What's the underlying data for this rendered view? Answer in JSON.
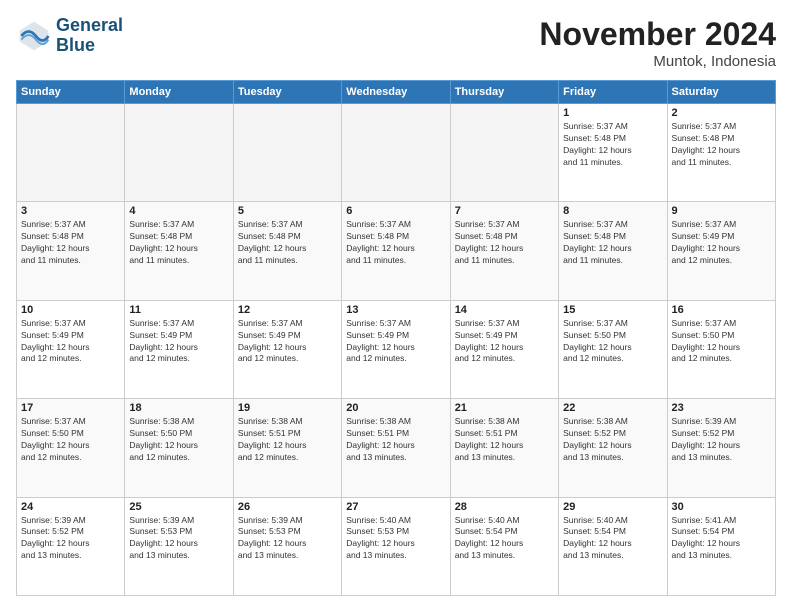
{
  "logo": {
    "line1": "General",
    "line2": "Blue"
  },
  "title": "November 2024",
  "location": "Muntok, Indonesia",
  "days_of_week": [
    "Sunday",
    "Monday",
    "Tuesday",
    "Wednesday",
    "Thursday",
    "Friday",
    "Saturday"
  ],
  "weeks": [
    [
      {
        "day": "",
        "info": ""
      },
      {
        "day": "",
        "info": ""
      },
      {
        "day": "",
        "info": ""
      },
      {
        "day": "",
        "info": ""
      },
      {
        "day": "",
        "info": ""
      },
      {
        "day": "1",
        "info": "Sunrise: 5:37 AM\nSunset: 5:48 PM\nDaylight: 12 hours\nand 11 minutes."
      },
      {
        "day": "2",
        "info": "Sunrise: 5:37 AM\nSunset: 5:48 PM\nDaylight: 12 hours\nand 11 minutes."
      }
    ],
    [
      {
        "day": "3",
        "info": "Sunrise: 5:37 AM\nSunset: 5:48 PM\nDaylight: 12 hours\nand 11 minutes."
      },
      {
        "day": "4",
        "info": "Sunrise: 5:37 AM\nSunset: 5:48 PM\nDaylight: 12 hours\nand 11 minutes."
      },
      {
        "day": "5",
        "info": "Sunrise: 5:37 AM\nSunset: 5:48 PM\nDaylight: 12 hours\nand 11 minutes."
      },
      {
        "day": "6",
        "info": "Sunrise: 5:37 AM\nSunset: 5:48 PM\nDaylight: 12 hours\nand 11 minutes."
      },
      {
        "day": "7",
        "info": "Sunrise: 5:37 AM\nSunset: 5:48 PM\nDaylight: 12 hours\nand 11 minutes."
      },
      {
        "day": "8",
        "info": "Sunrise: 5:37 AM\nSunset: 5:48 PM\nDaylight: 12 hours\nand 11 minutes."
      },
      {
        "day": "9",
        "info": "Sunrise: 5:37 AM\nSunset: 5:49 PM\nDaylight: 12 hours\nand 12 minutes."
      }
    ],
    [
      {
        "day": "10",
        "info": "Sunrise: 5:37 AM\nSunset: 5:49 PM\nDaylight: 12 hours\nand 12 minutes."
      },
      {
        "day": "11",
        "info": "Sunrise: 5:37 AM\nSunset: 5:49 PM\nDaylight: 12 hours\nand 12 minutes."
      },
      {
        "day": "12",
        "info": "Sunrise: 5:37 AM\nSunset: 5:49 PM\nDaylight: 12 hours\nand 12 minutes."
      },
      {
        "day": "13",
        "info": "Sunrise: 5:37 AM\nSunset: 5:49 PM\nDaylight: 12 hours\nand 12 minutes."
      },
      {
        "day": "14",
        "info": "Sunrise: 5:37 AM\nSunset: 5:49 PM\nDaylight: 12 hours\nand 12 minutes."
      },
      {
        "day": "15",
        "info": "Sunrise: 5:37 AM\nSunset: 5:50 PM\nDaylight: 12 hours\nand 12 minutes."
      },
      {
        "day": "16",
        "info": "Sunrise: 5:37 AM\nSunset: 5:50 PM\nDaylight: 12 hours\nand 12 minutes."
      }
    ],
    [
      {
        "day": "17",
        "info": "Sunrise: 5:37 AM\nSunset: 5:50 PM\nDaylight: 12 hours\nand 12 minutes."
      },
      {
        "day": "18",
        "info": "Sunrise: 5:38 AM\nSunset: 5:50 PM\nDaylight: 12 hours\nand 12 minutes."
      },
      {
        "day": "19",
        "info": "Sunrise: 5:38 AM\nSunset: 5:51 PM\nDaylight: 12 hours\nand 12 minutes."
      },
      {
        "day": "20",
        "info": "Sunrise: 5:38 AM\nSunset: 5:51 PM\nDaylight: 12 hours\nand 13 minutes."
      },
      {
        "day": "21",
        "info": "Sunrise: 5:38 AM\nSunset: 5:51 PM\nDaylight: 12 hours\nand 13 minutes."
      },
      {
        "day": "22",
        "info": "Sunrise: 5:38 AM\nSunset: 5:52 PM\nDaylight: 12 hours\nand 13 minutes."
      },
      {
        "day": "23",
        "info": "Sunrise: 5:39 AM\nSunset: 5:52 PM\nDaylight: 12 hours\nand 13 minutes."
      }
    ],
    [
      {
        "day": "24",
        "info": "Sunrise: 5:39 AM\nSunset: 5:52 PM\nDaylight: 12 hours\nand 13 minutes."
      },
      {
        "day": "25",
        "info": "Sunrise: 5:39 AM\nSunset: 5:53 PM\nDaylight: 12 hours\nand 13 minutes."
      },
      {
        "day": "26",
        "info": "Sunrise: 5:39 AM\nSunset: 5:53 PM\nDaylight: 12 hours\nand 13 minutes."
      },
      {
        "day": "27",
        "info": "Sunrise: 5:40 AM\nSunset: 5:53 PM\nDaylight: 12 hours\nand 13 minutes."
      },
      {
        "day": "28",
        "info": "Sunrise: 5:40 AM\nSunset: 5:54 PM\nDaylight: 12 hours\nand 13 minutes."
      },
      {
        "day": "29",
        "info": "Sunrise: 5:40 AM\nSunset: 5:54 PM\nDaylight: 12 hours\nand 13 minutes."
      },
      {
        "day": "30",
        "info": "Sunrise: 5:41 AM\nSunset: 5:54 PM\nDaylight: 12 hours\nand 13 minutes."
      }
    ]
  ]
}
